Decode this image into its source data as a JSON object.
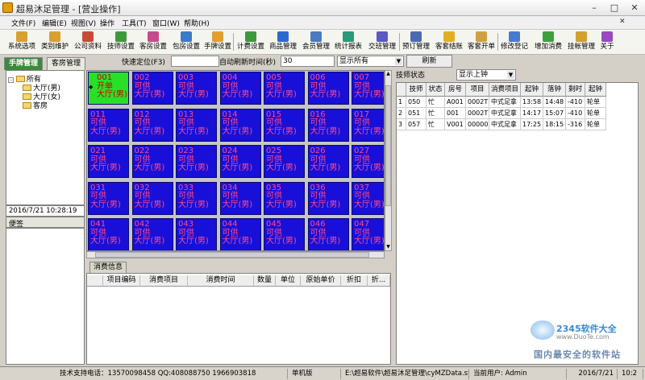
{
  "window": {
    "title": "超易沐足管理 - [营业操作]",
    "min": "–",
    "max": "□",
    "close": "✕"
  },
  "menu": [
    "文件(F)",
    "编辑(E)",
    "视图(V)",
    "操作",
    "工具(T)",
    "窗口(W)",
    "帮助(H)"
  ],
  "toolbar": [
    {
      "label": "系统选项",
      "icon": "system-options-icon",
      "color": "#d8a030"
    },
    {
      "label": "类别维护",
      "icon": "category-icon",
      "color": "#d8a030"
    },
    {
      "label": "公司资料",
      "icon": "company-icon",
      "color": "#c84a3a"
    },
    {
      "label": "技师设置",
      "icon": "technician-icon",
      "color": "#3c9a3c"
    },
    {
      "label": "客房设置",
      "icon": "guest-room-icon",
      "color": "#c84a8a"
    },
    {
      "label": "包房设置",
      "icon": "private-room-icon",
      "color": "#3a7ac8"
    },
    {
      "label": "手牌设置",
      "icon": "hand-tag-icon",
      "color": "#e0a030"
    },
    {
      "label": "计费设置",
      "icon": "billing-icon",
      "color": "#3c9a3c"
    },
    {
      "label": "商品管理",
      "icon": "goods-icon",
      "color": "#2a6ad0"
    },
    {
      "label": "会员管理",
      "icon": "member-icon",
      "color": "#4a7ac0"
    },
    {
      "label": "统计报表",
      "icon": "report-icon",
      "color": "#2a9a7a"
    },
    {
      "label": "交班管理",
      "icon": "shift-icon",
      "color": "#5a5ac0"
    },
    {
      "label": "预订管理",
      "icon": "booking-icon",
      "color": "#4a6ab0"
    },
    {
      "label": "客套结账",
      "icon": "checkout-icon",
      "color": "#e0b020"
    },
    {
      "label": "客套开单",
      "icon": "open-order-icon",
      "color": "#d0a040"
    },
    {
      "label": "修改登记",
      "icon": "edit-record-icon",
      "color": "#4a7ad0"
    },
    {
      "label": "增加消费",
      "icon": "add-consumption-icon",
      "color": "#3ca03c"
    },
    {
      "label": "挂帐管理",
      "icon": "credit-icon",
      "color": "#d0a030"
    },
    {
      "label": "关于",
      "icon": "about-icon",
      "color": "#9a4ac0"
    }
  ],
  "tabs": [
    "手牌管理",
    "客房管理"
  ],
  "quickbar": {
    "locate_label": "快速定位(F3)",
    "locate_value": "",
    "refresh_label": "自动刷新时间(秒)",
    "refresh_value": "30",
    "filter_value": "显示所有",
    "refresh_button": "刷新"
  },
  "tree": {
    "root": "所有",
    "children": [
      "大厅(男)",
      "大厅(女)",
      "客房"
    ]
  },
  "clock": "2016/7/21 10:28:19",
  "memo_label": "便签",
  "rooms": [
    {
      "no": "001",
      "status": "开单",
      "area": "大厅(男)",
      "busy": true
    },
    {
      "no": "002",
      "status": "可供",
      "area": "大厅(男)"
    },
    {
      "no": "003",
      "status": "可供",
      "area": "大厅(男)"
    },
    {
      "no": "004",
      "status": "可供",
      "area": "大厅(男)"
    },
    {
      "no": "005",
      "status": "可供",
      "area": "大厅(男)"
    },
    {
      "no": "006",
      "status": "可供",
      "area": "大厅(男)"
    },
    {
      "no": "007",
      "status": "可供",
      "area": "大厅(男)"
    },
    {
      "no": "011",
      "status": "可供",
      "area": "大厅(男)"
    },
    {
      "no": "012",
      "status": "可供",
      "area": "大厅(男)"
    },
    {
      "no": "013",
      "status": "可供",
      "area": "大厅(男)"
    },
    {
      "no": "014",
      "status": "可供",
      "area": "大厅(男)"
    },
    {
      "no": "015",
      "status": "可供",
      "area": "大厅(男)"
    },
    {
      "no": "016",
      "status": "可供",
      "area": "大厅(男)"
    },
    {
      "no": "017",
      "status": "可供",
      "area": "大厅(男)"
    },
    {
      "no": "021",
      "status": "可供",
      "area": "大厅(男)"
    },
    {
      "no": "022",
      "status": "可供",
      "area": "大厅(男)"
    },
    {
      "no": "023",
      "status": "可供",
      "area": "大厅(男)"
    },
    {
      "no": "024",
      "status": "可供",
      "area": "大厅(男)"
    },
    {
      "no": "025",
      "status": "可供",
      "area": "大厅(男)"
    },
    {
      "no": "026",
      "status": "可供",
      "area": "大厅(男)"
    },
    {
      "no": "027",
      "status": "可供",
      "area": "大厅(男)"
    },
    {
      "no": "031",
      "status": "可供",
      "area": "大厅(男)"
    },
    {
      "no": "032",
      "status": "可供",
      "area": "大厅(男)"
    },
    {
      "no": "033",
      "status": "可供",
      "area": "大厅(男)"
    },
    {
      "no": "034",
      "status": "可供",
      "area": "大厅(男)"
    },
    {
      "no": "035",
      "status": "可供",
      "area": "大厅(男)"
    },
    {
      "no": "036",
      "status": "可供",
      "area": "大厅(男)"
    },
    {
      "no": "037",
      "status": "可供",
      "area": "大厅(男)"
    },
    {
      "no": "041",
      "status": "可供",
      "area": "大厅(男)"
    },
    {
      "no": "042",
      "status": "可供",
      "area": "大厅(男)"
    },
    {
      "no": "043",
      "status": "可供",
      "area": "大厅(男)"
    },
    {
      "no": "044",
      "status": "可供",
      "area": "大厅(男)"
    },
    {
      "no": "045",
      "status": "可供",
      "area": "大厅(男)"
    },
    {
      "no": "046",
      "status": "可供",
      "area": "大厅(男)"
    },
    {
      "no": "047",
      "status": "可供",
      "area": "大厅(男)"
    }
  ],
  "consume": {
    "tab": "消费信息",
    "columns": [
      "项目编码",
      "消费项目",
      "消费时间",
      "数量",
      "单位",
      "原始单价",
      "折扣",
      "折..."
    ]
  },
  "tech": {
    "label": "技师状态",
    "filter": "显示上钟",
    "columns": [
      "",
      "技师",
      "状态",
      "房号",
      "项目",
      "消费项目",
      "起钟",
      "落钟",
      "剩时",
      "起钟"
    ],
    "rows": [
      [
        "1",
        "050",
        "忙",
        "A001",
        "0002T",
        "中式足拿",
        "13:58",
        "14:48",
        "-410",
        "轮单"
      ],
      [
        "2",
        "051",
        "忙",
        "001",
        "0002T",
        "中式足拿",
        "14:17",
        "15:07",
        "-410",
        "轮单"
      ],
      [
        "3",
        "057",
        "忙",
        "V001",
        "00000",
        "中式足拿",
        "17:25",
        "18:15",
        "-316",
        "轮单"
      ]
    ]
  },
  "status": {
    "support": "技术支持电话：13570098458 QQ:408088750 1966903818",
    "edition": "单机版",
    "path": "E:\\超易软件\\超易沐足管理\\cyMZData.sys",
    "user": "当前用户: Admin",
    "date": "2016/7/21",
    "time": "10:2"
  },
  "watermark": {
    "brand": "2345软件大全",
    "url": "www.DuoTe.com",
    "slogan": "国内最安全的软件站"
  },
  "colors": {
    "room_free": "#1810d8",
    "room_busy": "#28e028",
    "room_text": "#ff4a8a",
    "active_tab": "#3c8a3c"
  }
}
